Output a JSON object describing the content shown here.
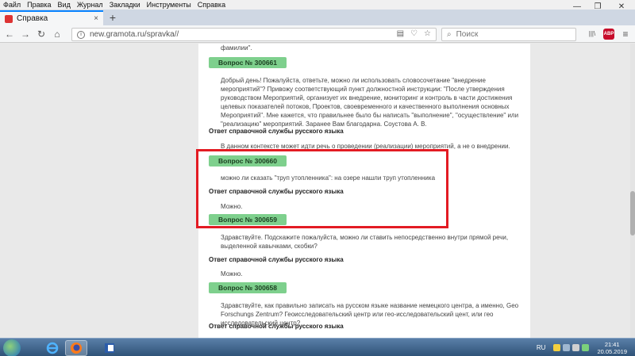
{
  "menu": [
    "Файл",
    "Правка",
    "Вид",
    "Журнал",
    "Закладки",
    "Инструменты",
    "Справка"
  ],
  "window_controls": {
    "minimize": "—",
    "maximize": "❐",
    "close": "✕"
  },
  "tab": {
    "title": "Справка",
    "close": "×",
    "new_tab": "+"
  },
  "navbar": {
    "back": "←",
    "forward": "→",
    "reload": "↻",
    "home": "⌂"
  },
  "url": {
    "info": "i",
    "text": "new.gramota.ru/spravka//",
    "reader": "▤",
    "pocket": "♡",
    "star": "☆"
  },
  "search": {
    "placeholder": "Поиск",
    "icon": "⌕"
  },
  "toolbar_right": {
    "library": "|||\\",
    "abp": "ABP",
    "menu": "≡"
  },
  "page": {
    "top_fragment": "фамилии\".",
    "questions": [
      {
        "badge": "Вопрос № 300661",
        "text": "Добрый день! Пожалуйста, ответьте, можно ли использовать словосочетание \"внедрение мероприятий\"? Привожу соответствующий пункт должностной инструкции: \"После утверждения руководством Мероприятий, организует их внедрение, мониторинг и контроль в части достижения целевых показателей потоков, Проектов, своевременного и качественного выполнения основных Мероприятий\". Мне кажется, что правильнее было бы написать \"выполнение\", \"осуществление\" или \"реализацию\" мероприятий. Заранее Вам благодарна. Соустова А. В.",
        "answer_heading": "Ответ справочной службы русского языка",
        "answer": "В данном контексте может идти речь о проведении (реализации) мероприятий, а не о внедрении."
      },
      {
        "badge": "Вопрос № 300660",
        "text": "можно ли сказать \"труп утопленника\": на озере нашли труп утопленника",
        "answer_heading": "Ответ справочной службы русского языка",
        "answer": "Можно."
      },
      {
        "badge": "Вопрос № 300659",
        "text": "Здравствуйте. Подскажите пожалуйста, можно ли ставить непосредственно внутри прямой речи, выделенной кавычками, скобки?",
        "answer_heading": "Ответ справочной службы русского языка",
        "answer": "Можно."
      },
      {
        "badge": "Вопрос № 300658",
        "text": "Здравствуйте, как правильно записать на русском языке название немецкого центра, а именно, Geo Forschungs Zentrum? Геоисследовательский центр или гео-исследовательский цент, или гео исследовательский центр?",
        "answer_heading": "Ответ справочной службы русского языка",
        "answer": ""
      }
    ]
  },
  "taskbar": {
    "lang": "RU",
    "time": "21:41",
    "date": "20.05.2019"
  }
}
